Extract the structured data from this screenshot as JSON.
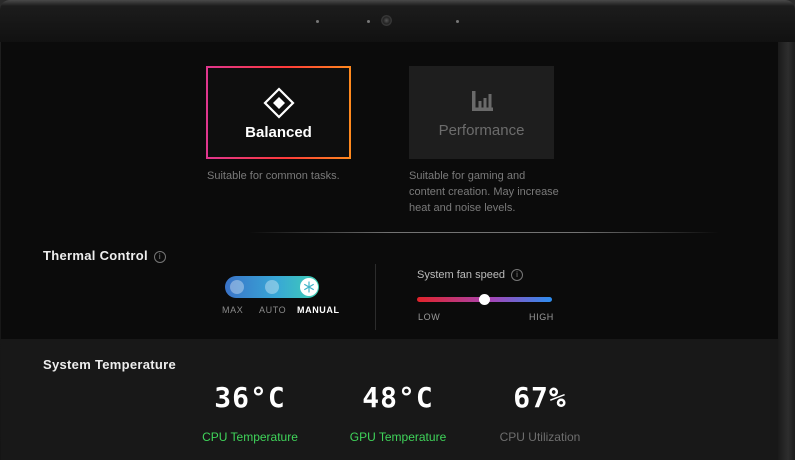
{
  "modes": [
    {
      "label": "Balanced",
      "description": "Suitable for common tasks.",
      "selected": true,
      "icon": "diamond-icon"
    },
    {
      "label": "Performance",
      "description_lines": [
        "Suitable for gaming and",
        "content creation. May increase",
        "heat and noise levels."
      ],
      "selected": false,
      "icon": "bar-chart-icon"
    }
  ],
  "thermal": {
    "title": "Thermal Control",
    "info_icon": "i",
    "options": [
      "MAX",
      "AUTO",
      "MANUAL"
    ],
    "selected": "MANUAL",
    "fan": {
      "title": "System fan speed",
      "low_label": "LOW",
      "high_label": "HIGH",
      "level": 0.5
    }
  },
  "temperature": {
    "title": "System Temperature",
    "stats": [
      {
        "value": "36°C",
        "label": "CPU Temperature",
        "label_color": "#3fd45a"
      },
      {
        "value": "48°C",
        "label": "GPU Temperature",
        "label_color": "#3fd45a"
      },
      {
        "value": "67%",
        "label": "CPU Utilization",
        "label_color": "#6e6e6e"
      }
    ]
  },
  "colors": {
    "accent_gradient": [
      "#e0368f",
      "#ff3a3a",
      "#ff8a1e"
    ],
    "toggle_gradient": [
      "#3a73c8",
      "#3fd0b4"
    ],
    "fan_gradient": [
      "#e2232a",
      "#2c8ef0"
    ]
  }
}
